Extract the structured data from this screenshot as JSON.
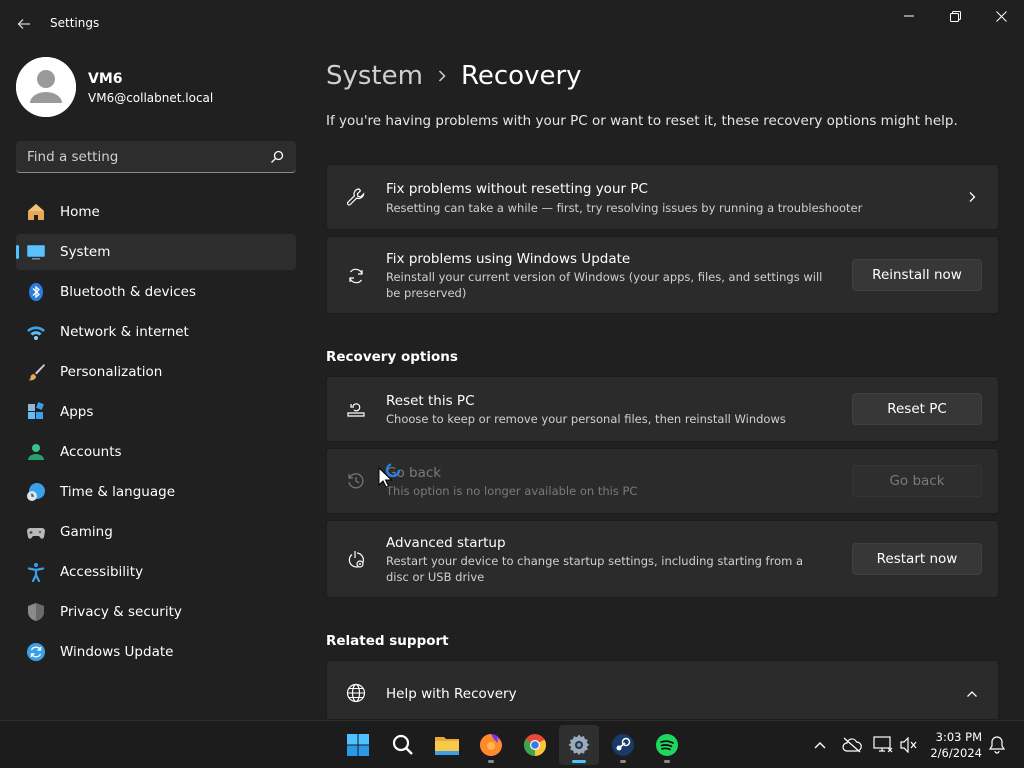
{
  "window": {
    "title": "Settings"
  },
  "user": {
    "name": "VM6",
    "email": "VM6@collabnet.local"
  },
  "search": {
    "placeholder": "Find a setting"
  },
  "sidebar": {
    "items": [
      {
        "label": "Home",
        "icon": "home-icon"
      },
      {
        "label": "System",
        "icon": "system-icon",
        "active": true
      },
      {
        "label": "Bluetooth & devices",
        "icon": "bluetooth-icon"
      },
      {
        "label": "Network & internet",
        "icon": "network-icon"
      },
      {
        "label": "Personalization",
        "icon": "brush-icon"
      },
      {
        "label": "Apps",
        "icon": "apps-icon"
      },
      {
        "label": "Accounts",
        "icon": "accounts-icon"
      },
      {
        "label": "Time & language",
        "icon": "clock-globe-icon"
      },
      {
        "label": "Gaming",
        "icon": "gamepad-icon"
      },
      {
        "label": "Accessibility",
        "icon": "accessibility-icon"
      },
      {
        "label": "Privacy & security",
        "icon": "shield-icon"
      },
      {
        "label": "Windows Update",
        "icon": "update-icon"
      }
    ]
  },
  "breadcrumb": {
    "parent": "System",
    "current": "Recovery"
  },
  "intro": "If you're having problems with your PC or want to reset it, these recovery options might help.",
  "cards": {
    "fix_no_reset": {
      "title": "Fix problems without resetting your PC",
      "desc": "Resetting can take a while — first, try resolving issues by running a troubleshooter"
    },
    "fix_update": {
      "title": "Fix problems using Windows Update",
      "desc": "Reinstall your current version of Windows (your apps, files, and settings will be preserved)",
      "button": "Reinstall now"
    }
  },
  "recovery_options": {
    "heading": "Recovery options",
    "reset": {
      "title": "Reset this PC",
      "desc": "Choose to keep or remove your personal files, then reinstall Windows",
      "button": "Reset PC"
    },
    "go_back": {
      "title": "Go back",
      "desc": "This option is no longer available on this PC",
      "button": "Go back"
    },
    "advanced": {
      "title": "Advanced startup",
      "desc": "Restart your device to change startup settings, including starting from a disc or USB drive",
      "button": "Restart now"
    }
  },
  "related_support": {
    "heading": "Related support",
    "help": {
      "title": "Help with Recovery"
    }
  },
  "taskbar": {
    "clock": {
      "time": "3:03 PM",
      "date": "2/6/2024"
    }
  },
  "colors": {
    "accent": "#4cc2ff",
    "background": "#202020",
    "card": "#2b2b2b"
  }
}
